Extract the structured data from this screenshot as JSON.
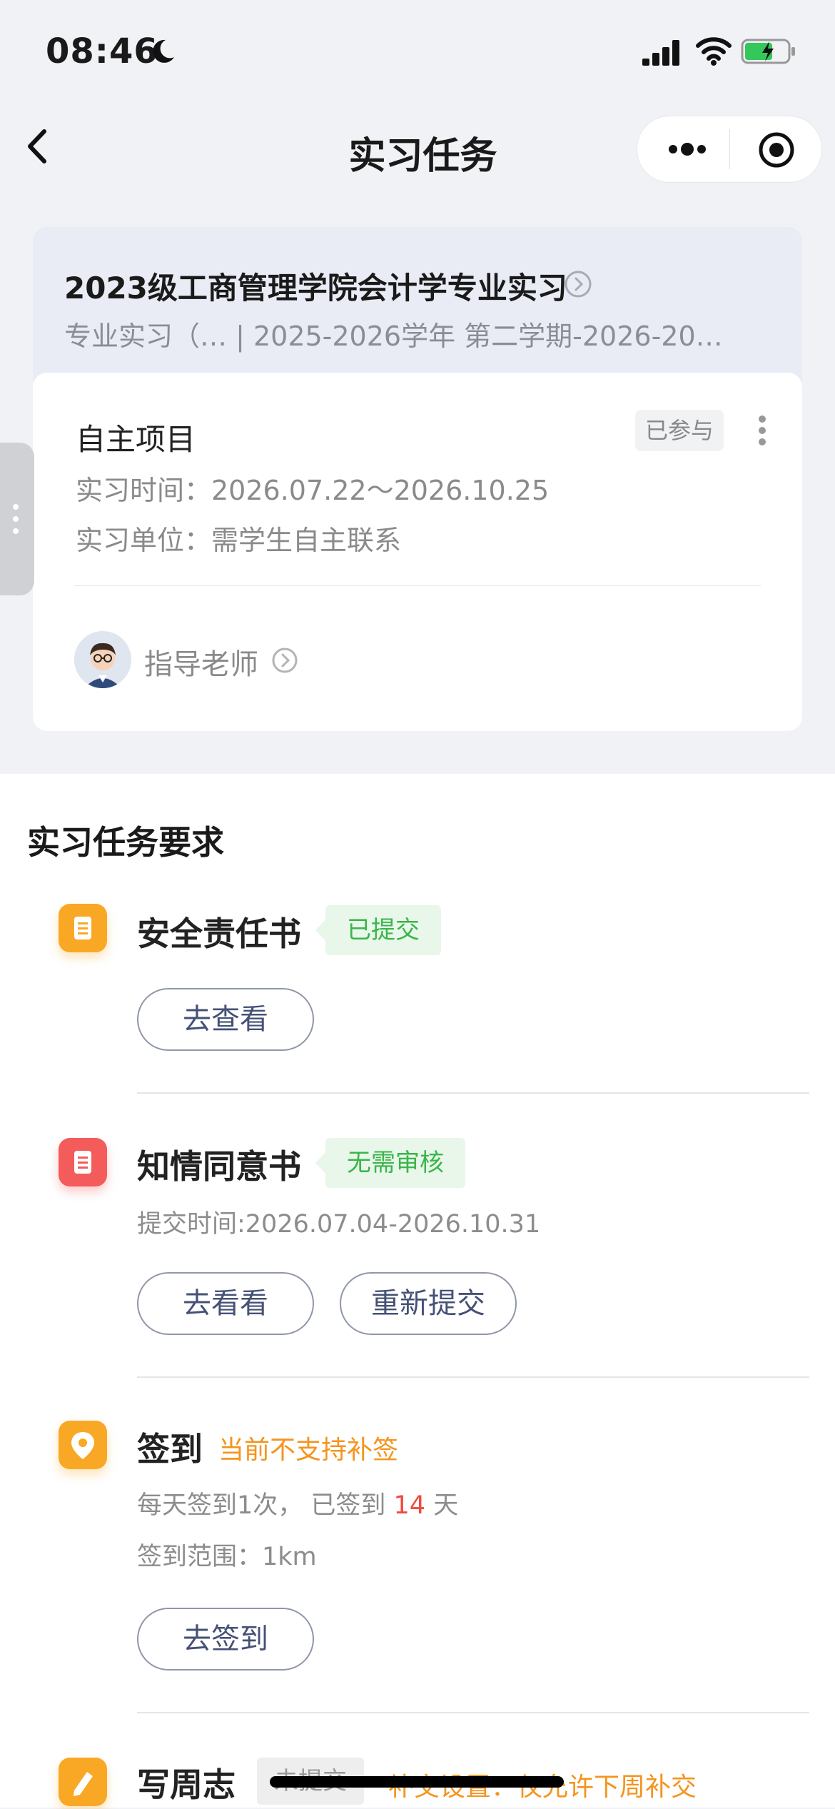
{
  "status_bar": {
    "time": "08:46"
  },
  "nav": {
    "title": "实习任务"
  },
  "header": {
    "title": "2023级工商管理学院会计学专业实习",
    "subtitle": "专业实习（…   | 2025-2026学年 第二学期-2026-20…"
  },
  "project": {
    "name": "自主项目",
    "status_badge": "已参与",
    "time_line": "实习时间：2026.07.22～2026.10.25",
    "unit_line": "实习单位：需学生自主联系",
    "teacher_label": "指导老师"
  },
  "requirements": {
    "title": "实习任务要求",
    "tasks": [
      {
        "name": "安全责任书",
        "tag": "已提交",
        "buttons": [
          "去查看"
        ],
        "icon": "document-icon",
        "icon_color": "#f9a825"
      },
      {
        "name": "知情同意书",
        "tag": "无需审核",
        "sub": "提交时间:2026.07.04-2026.10.31",
        "buttons": [
          "去看看",
          "重新提交"
        ],
        "icon": "document-icon",
        "icon_color": "#f45b5b"
      },
      {
        "name": "签到",
        "tag": "当前不支持补签",
        "sub_prefix": "每天签到1次，  已签到 ",
        "sub_count": "14",
        "sub_suffix": " 天",
        "sub2": "签到范围：1km",
        "buttons": [
          "去签到"
        ],
        "icon": "location-pin-icon",
        "icon_color": "#f9a825"
      },
      {
        "name": "写周志",
        "tag": "未提交",
        "note": "补交设置：仅允许下周补交",
        "icon": "pencil-icon",
        "icon_color": "#f9a825"
      }
    ]
  },
  "colors": {
    "accent_green": "#3bb54a",
    "accent_orange": "#f5941d",
    "count_red": "#f04a3e"
  }
}
